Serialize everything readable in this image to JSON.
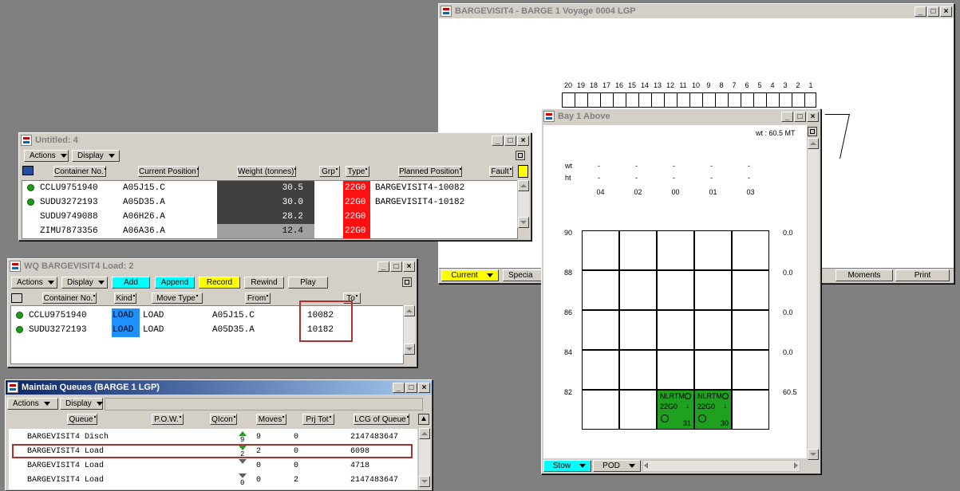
{
  "barge_window": {
    "title": "BARGEVISIT4 - BARGE 1  Voyage 0004 LGP",
    "bay_numbers": [
      "20",
      "19",
      "18",
      "17",
      "16",
      "15",
      "14",
      "13",
      "12",
      "11",
      "10",
      "9",
      "8",
      "7",
      "6",
      "5",
      "4",
      "3",
      "2",
      "1"
    ],
    "bottom": {
      "current": "Current",
      "special": "Specia",
      "moments": "Moments",
      "print": "Print"
    }
  },
  "untitled_window": {
    "title": "Untitled: 4",
    "actions": "Actions",
    "display": "Display",
    "headers": [
      "Container No.",
      "Current Position",
      "Weight (tonnes)",
      "Grp",
      "Type",
      "Planned Position",
      "Fault"
    ],
    "rows": [
      {
        "container": "CCLU9751940",
        "position": "A05J15.C",
        "weight": "30.5",
        "type": "22G0",
        "planned": "BARGEVISIT4-10082"
      },
      {
        "container": "SUDU3272193",
        "position": "A05D35.A",
        "weight": "30.0",
        "type": "22G0",
        "planned": "BARGEVISIT4-10182"
      },
      {
        "container": "SUDU9749088",
        "position": "A06H26.A",
        "weight": "28.2",
        "type": "22G0",
        "planned": ""
      },
      {
        "container": "ZIMU7873356",
        "position": "A06A36.A",
        "weight": "12.4",
        "type": "22G0",
        "planned": ""
      }
    ]
  },
  "wq_window": {
    "title": "WQ BARGEVISIT4 Load:  2",
    "actions": "Actions",
    "display": "Display",
    "add": "Add",
    "append": "Append",
    "record": "Record",
    "rewind": "Rewind",
    "play": "Play",
    "headers": [
      "Container No.",
      "Kind",
      "Move Type",
      "From",
      "To"
    ],
    "rows": [
      {
        "container": "CCLU9751940",
        "kind": "LOAD",
        "move": "LOAD",
        "from": "A05J15.C",
        "to": "10082"
      },
      {
        "container": "SUDU3272193",
        "kind": "LOAD",
        "move": "LOAD",
        "from": "A05D35.A",
        "to": "10182"
      }
    ]
  },
  "queues_window": {
    "title": "Maintain Queues (BARGE 1 LGP)",
    "actions": "Actions",
    "display": "Display",
    "headers": [
      "Queue",
      "P.O.W.",
      "QIcon",
      "Moves",
      "Prj Tot",
      "LCG of Queue"
    ],
    "rows": [
      {
        "queue": "BARGEVISIT4 Disch",
        "icon": "9",
        "moves": "9",
        "prj": "0",
        "lcg": "2147483647"
      },
      {
        "queue": "BARGEVISIT4 Load",
        "icon": "2",
        "moves": "2",
        "prj": "0",
        "lcg": "6098"
      },
      {
        "queue": "BARGEVISIT4 Load",
        "icon": "",
        "moves": "0",
        "prj": "0",
        "lcg": "4718"
      },
      {
        "queue": "BARGEVISIT4 Load",
        "icon": "0",
        "moves": "0",
        "prj": "2",
        "lcg": "2147483647"
      }
    ]
  },
  "bay_window": {
    "title": "Bay 1 Above",
    "wt_total": "wt : 60.5 MT",
    "wt_label": "wt",
    "ht_label": "ht",
    "dash": "-",
    "columns": [
      "04",
      "02",
      "00",
      "01",
      "03"
    ],
    "tiers": [
      "90",
      "88",
      "86",
      "84",
      "82"
    ],
    "tier_weights": [
      "0.0",
      "0.0",
      "0.0",
      "0.0",
      "60.5"
    ],
    "containers": [
      {
        "pod": "NLRTM",
        "type": "22G0",
        "weight": "31"
      },
      {
        "pod": "NLRTM",
        "type": "22G0",
        "weight": "30"
      }
    ],
    "bottom": {
      "stow": "Stow",
      "pod": "POD"
    }
  },
  "colors": {
    "highlight_cyan": "#00ffff",
    "highlight_yellow": "#ffff00",
    "load_blue": "#1e90ff",
    "type_red": "#ff1010",
    "cont_green": "#20a020"
  }
}
